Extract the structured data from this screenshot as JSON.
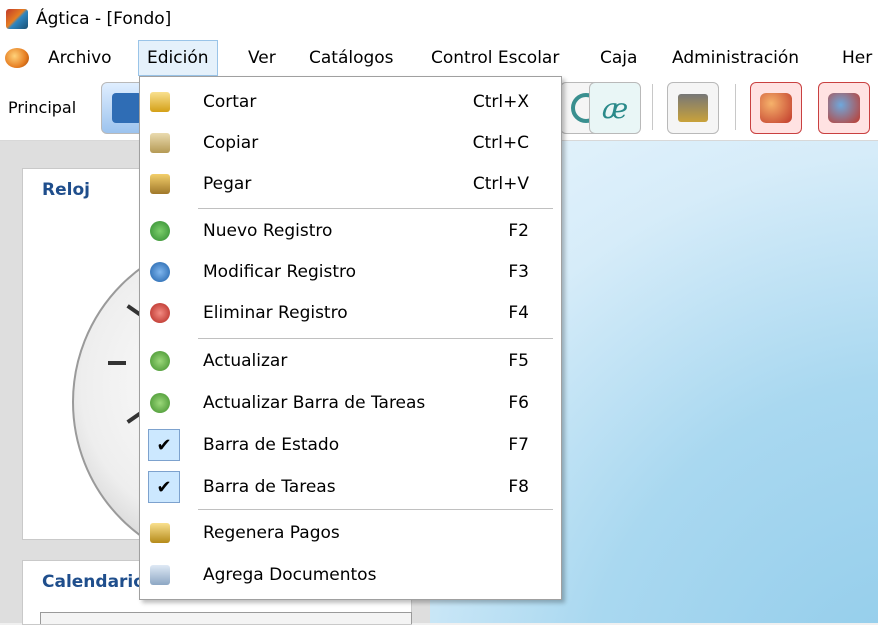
{
  "window": {
    "title": "Ágtica - [Fondo]"
  },
  "menubar": {
    "items": [
      {
        "label": "Archivo"
      },
      {
        "label": "Edición"
      },
      {
        "label": "Ver"
      },
      {
        "label": "Catálogos"
      },
      {
        "label": "Control Escolar"
      },
      {
        "label": "Caja"
      },
      {
        "label": "Administración"
      },
      {
        "label": "Her"
      }
    ]
  },
  "toolbar": {
    "label": "Principal"
  },
  "panels": {
    "clock_title": "Reloj",
    "calendar_title": "Calendario"
  },
  "edit_menu": {
    "items": [
      {
        "label": "Cortar",
        "shortcut": "Ctrl+X",
        "icon": "cut-icon"
      },
      {
        "label": "Copiar",
        "shortcut": "Ctrl+C",
        "icon": "copy-icon"
      },
      {
        "label": "Pegar",
        "shortcut": "Ctrl+V",
        "icon": "paste-icon"
      },
      {
        "label": "Nuevo Registro",
        "shortcut": "F2",
        "icon": "add-record-icon"
      },
      {
        "label": "Modificar Registro",
        "shortcut": "F3",
        "icon": "edit-record-icon"
      },
      {
        "label": "Eliminar Registro",
        "shortcut": "F4",
        "icon": "delete-record-icon"
      },
      {
        "label": "Actualizar",
        "shortcut": "F5",
        "icon": "refresh-icon"
      },
      {
        "label": "Actualizar Barra de Tareas",
        "shortcut": "F6",
        "icon": "refresh-taskbar-icon"
      },
      {
        "label": "Barra de Estado",
        "shortcut": "F7",
        "checked": true
      },
      {
        "label": "Barra de Tareas",
        "shortcut": "F8",
        "checked": true
      },
      {
        "label": "Regenera Pagos",
        "icon": "regenerate-payments-icon"
      },
      {
        "label": "Agrega Documentos",
        "icon": "add-documents-icon"
      }
    ],
    "check_mark": "✔"
  }
}
